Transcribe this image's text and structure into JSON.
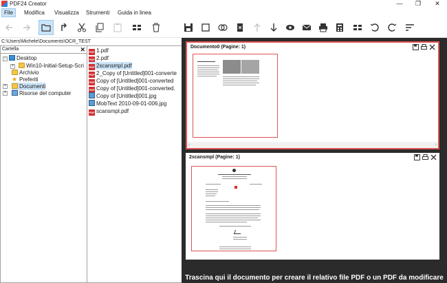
{
  "window": {
    "title": "PDF24 Creator",
    "minimize": "—",
    "maximize": "❐",
    "close": "✕"
  },
  "menu": {
    "items": [
      "File",
      "Modifica",
      "Visualizza",
      "Strumenti",
      "Guida in linea"
    ]
  },
  "toolbar": {
    "left": [
      "back-icon",
      "forward-icon",
      "folder-icon",
      "up-icon",
      "cut-icon",
      "copy-icon",
      "paste-icon",
      "view-icon",
      "delete-icon"
    ],
    "right": [
      "save-icon",
      "new-doc-icon",
      "merge-icon",
      "delete-doc-icon",
      "move-up-icon",
      "move-down-icon",
      "preview-icon",
      "email-icon",
      "print-icon",
      "calculator-icon",
      "grid-icon",
      "rotate-left-icon",
      "rotate-right-icon",
      "sort-icon"
    ]
  },
  "path": "C:\\Users\\Michele\\Documents\\OCR_TEST",
  "tree": {
    "header": "Cartella",
    "close": "✕",
    "items": [
      "Desktop",
      "Win10-Initial-Setup-Scri",
      "Archivio",
      "Preferiti",
      "Documenti",
      "Risorse del computer"
    ]
  },
  "files": [
    "1.pdf",
    "2.pdf",
    "2scansmpl.pdf",
    "2_Copy of [Untitled]001-converte",
    "Copy of [Untitled]001-converted",
    "Copy of [Untitled]001-converted.",
    "Copy of [Untitled]001.jpg",
    "MobText 2010-09-01-006.jpg",
    "scansmpl.pdf"
  ],
  "documents": [
    {
      "title": "Documento0 (Pagine: 1)"
    },
    {
      "title": "2scansmpl (Pagine: 1)"
    }
  ],
  "scroll": {
    "left": "‹",
    "right": "›"
  },
  "dropzone": "Trascina qui il documento per creare il relativo file PDF o un PDF da modificare",
  "colors": {
    "accent": "#e05252",
    "selection": "#cce4f7",
    "workspace": "#2b2b2b"
  }
}
